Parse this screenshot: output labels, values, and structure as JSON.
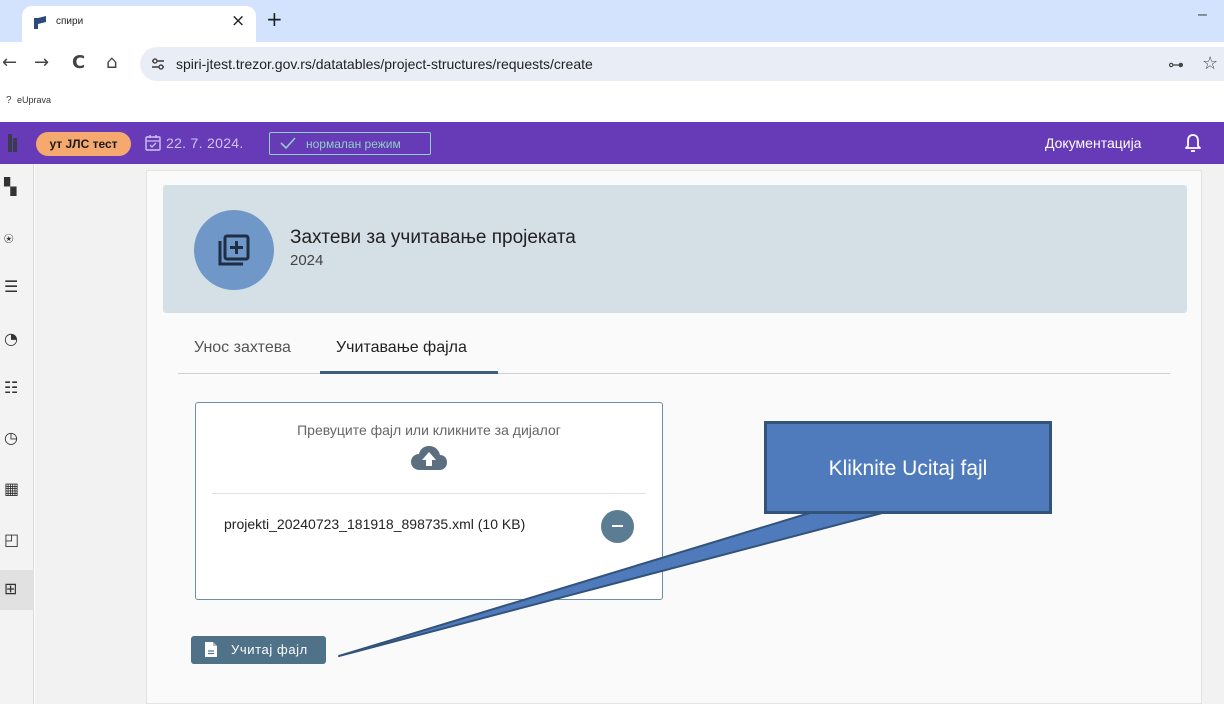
{
  "browser": {
    "tab_title": "спири",
    "tab_close": "×",
    "new_tab": "+",
    "minimize": "–",
    "url": "spiri-jtest.trezor.gov.rs/datatables/project-structures/requests/create",
    "nav": {
      "back": "←",
      "forward": "→",
      "reload": "C",
      "home": "⌂"
    },
    "key": "⊶",
    "star": "☆",
    "bookmark_icon": "?",
    "bookmark": "eUprava"
  },
  "app_header": {
    "env_chip": "ут ЈЛС тест",
    "date": "22. 7. 2024.",
    "mode": "нормалан режим",
    "docs": "Документација"
  },
  "sidebar": {
    "items": [
      {
        "icon": "dashboard-icon",
        "glyph": "▚"
      },
      {
        "icon": "payments-icon",
        "glyph": "⍟"
      },
      {
        "icon": "list-icon",
        "glyph": "☰"
      },
      {
        "icon": "chart-icon",
        "glyph": "◔"
      },
      {
        "icon": "clipboard-icon",
        "glyph": "☷"
      },
      {
        "icon": "history-icon",
        "glyph": "◷"
      },
      {
        "icon": "calculator-icon",
        "glyph": "▦"
      },
      {
        "icon": "accounts-icon",
        "glyph": "◰"
      },
      {
        "icon": "table-icon",
        "glyph": "⊞"
      }
    ],
    "active_index": 8
  },
  "page": {
    "title": "Захтеви за учитавање пројеката",
    "year": "2024",
    "tabs": [
      {
        "label": "Унос захтева",
        "active": false
      },
      {
        "label": "Учитавање фајла",
        "active": true
      }
    ]
  },
  "dropzone": {
    "hint": "Превуците фајл или кликните за дијалог",
    "file": "projekti_20240723_181918_898735.xml (10 KB)"
  },
  "upload_button": {
    "label": "Учитај фајл"
  },
  "callout": {
    "text": "Kliknite Ucitaj fajl"
  },
  "colors": {
    "header": "#673ab7",
    "env_chip": "#f6a96f",
    "mode": "#8fd1c3",
    "hero": "#d4dfe6",
    "hero_circle": "#6f97c8",
    "button": "#4f7289",
    "callout": "#4f7bbd"
  }
}
